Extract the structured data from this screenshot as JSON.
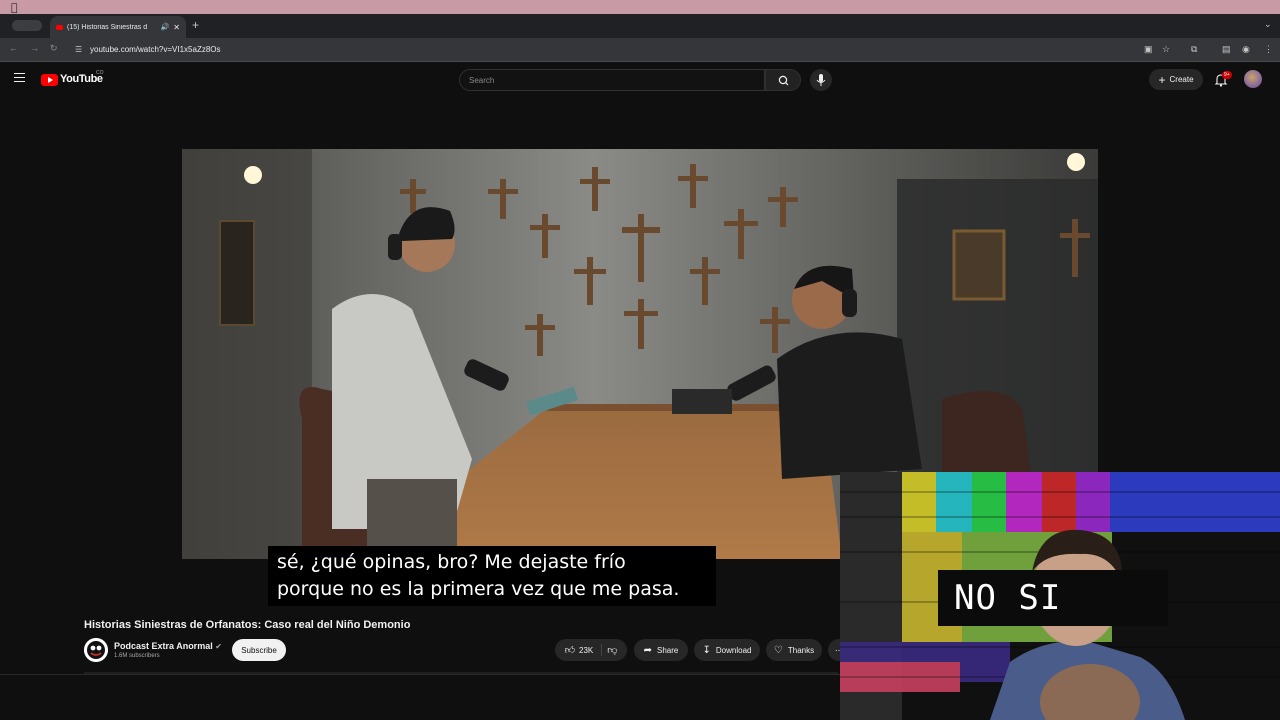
{
  "browser": {
    "tab_title": "(15) Historias Siniestras d",
    "url": "youtube.com/watch?v=VI1x5aZz8Os"
  },
  "youtube": {
    "logo_text": "YouTube",
    "logo_country": "CO",
    "search_placeholder": "Search",
    "create_label": "Create",
    "notification_count": "9+"
  },
  "video": {
    "captions": [
      "sé, ¿qué opinas, bro? Me dejaste frío",
      "porque no es la primera vez que me pasa."
    ],
    "title": "Historias Siniestras de Orfanatos: Caso real del Niño Demonio",
    "channel": "Podcast Extra Anormal",
    "subscribers": "1.6M subscribers",
    "subscribe_label": "Subscribe",
    "likes": "23K",
    "share_label": "Share",
    "download_label": "Download",
    "thanks_label": "Thanks"
  },
  "webcam_overlay": {
    "text": "NO SI"
  },
  "colors": {
    "youtube_red": "#ff0000",
    "background": "#0f0f0f",
    "menubar": "#c79aa6"
  }
}
